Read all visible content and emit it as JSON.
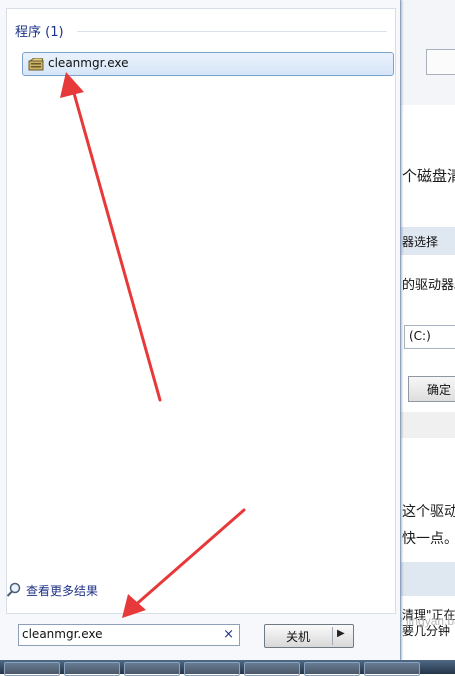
{
  "start_menu": {
    "section_title": "程序 (1)",
    "result_label": "cleanmgr.exe",
    "more_results": "查看更多结果",
    "search_value": "cleanmgr.exe",
    "shutdown_label": "关机"
  },
  "background_window": {
    "text1": "个磁盘清",
    "bar_label": "器选择",
    "text2": "的驱动器。",
    "drive": "(C:)",
    "ok_button": "确定",
    "text3": "这个驱动",
    "text4": "快一点。",
    "text5": "清理\"正在",
    "text6": "要几分钟"
  },
  "watermark": "Bai 经验 jingyan.baidu.com",
  "colors": {
    "annotation": "#e8393a",
    "link": "#1e3287",
    "selection": "#d6e6f8"
  },
  "icons": {
    "program": "program-icon",
    "search": "search-icon",
    "clear": "clear-icon",
    "shutdown_arrow": "arrow-right-icon"
  }
}
